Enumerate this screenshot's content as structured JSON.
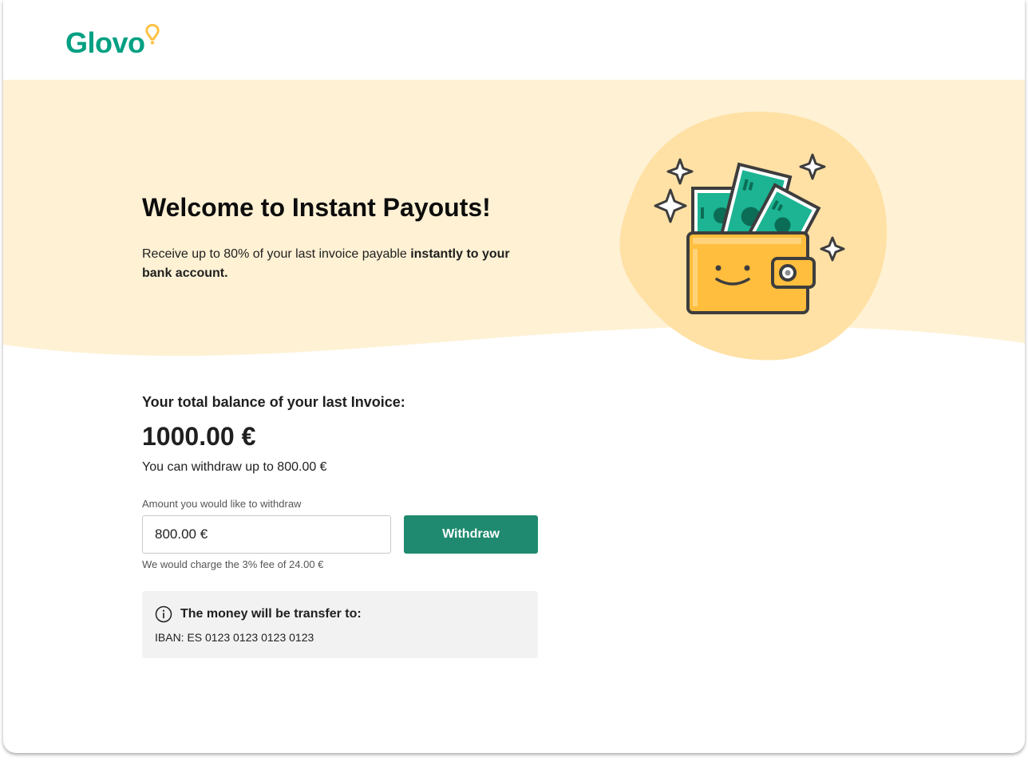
{
  "brand": {
    "name": "Glovo",
    "primary_color": "#00a082",
    "pin_color": "#ffc244"
  },
  "hero": {
    "title": "Welcome to Instant Payouts!",
    "description_prefix": "Receive up to 80% of your last invoice payable ",
    "description_bold": "instantly to your bank account.",
    "background_color": "#fff1d4",
    "illustration": "wallet-with-money-icon"
  },
  "balance": {
    "label": "Your total balance of your last Invoice:",
    "value": "1000.00 €",
    "withdraw_limit": "You can withdraw up to 800.00 €"
  },
  "withdraw_form": {
    "amount_label": "Amount you would like to withdraw",
    "amount_value": "800.00 €",
    "button_label": "Withdraw",
    "button_color": "#1f8a70",
    "fee_note": "We would charge the 3% fee of 24.00 €"
  },
  "transfer_info": {
    "icon": "info-icon",
    "title": "The money will be transfer to:",
    "iban": "IBAN: ES 0123 0123 0123 0123"
  }
}
